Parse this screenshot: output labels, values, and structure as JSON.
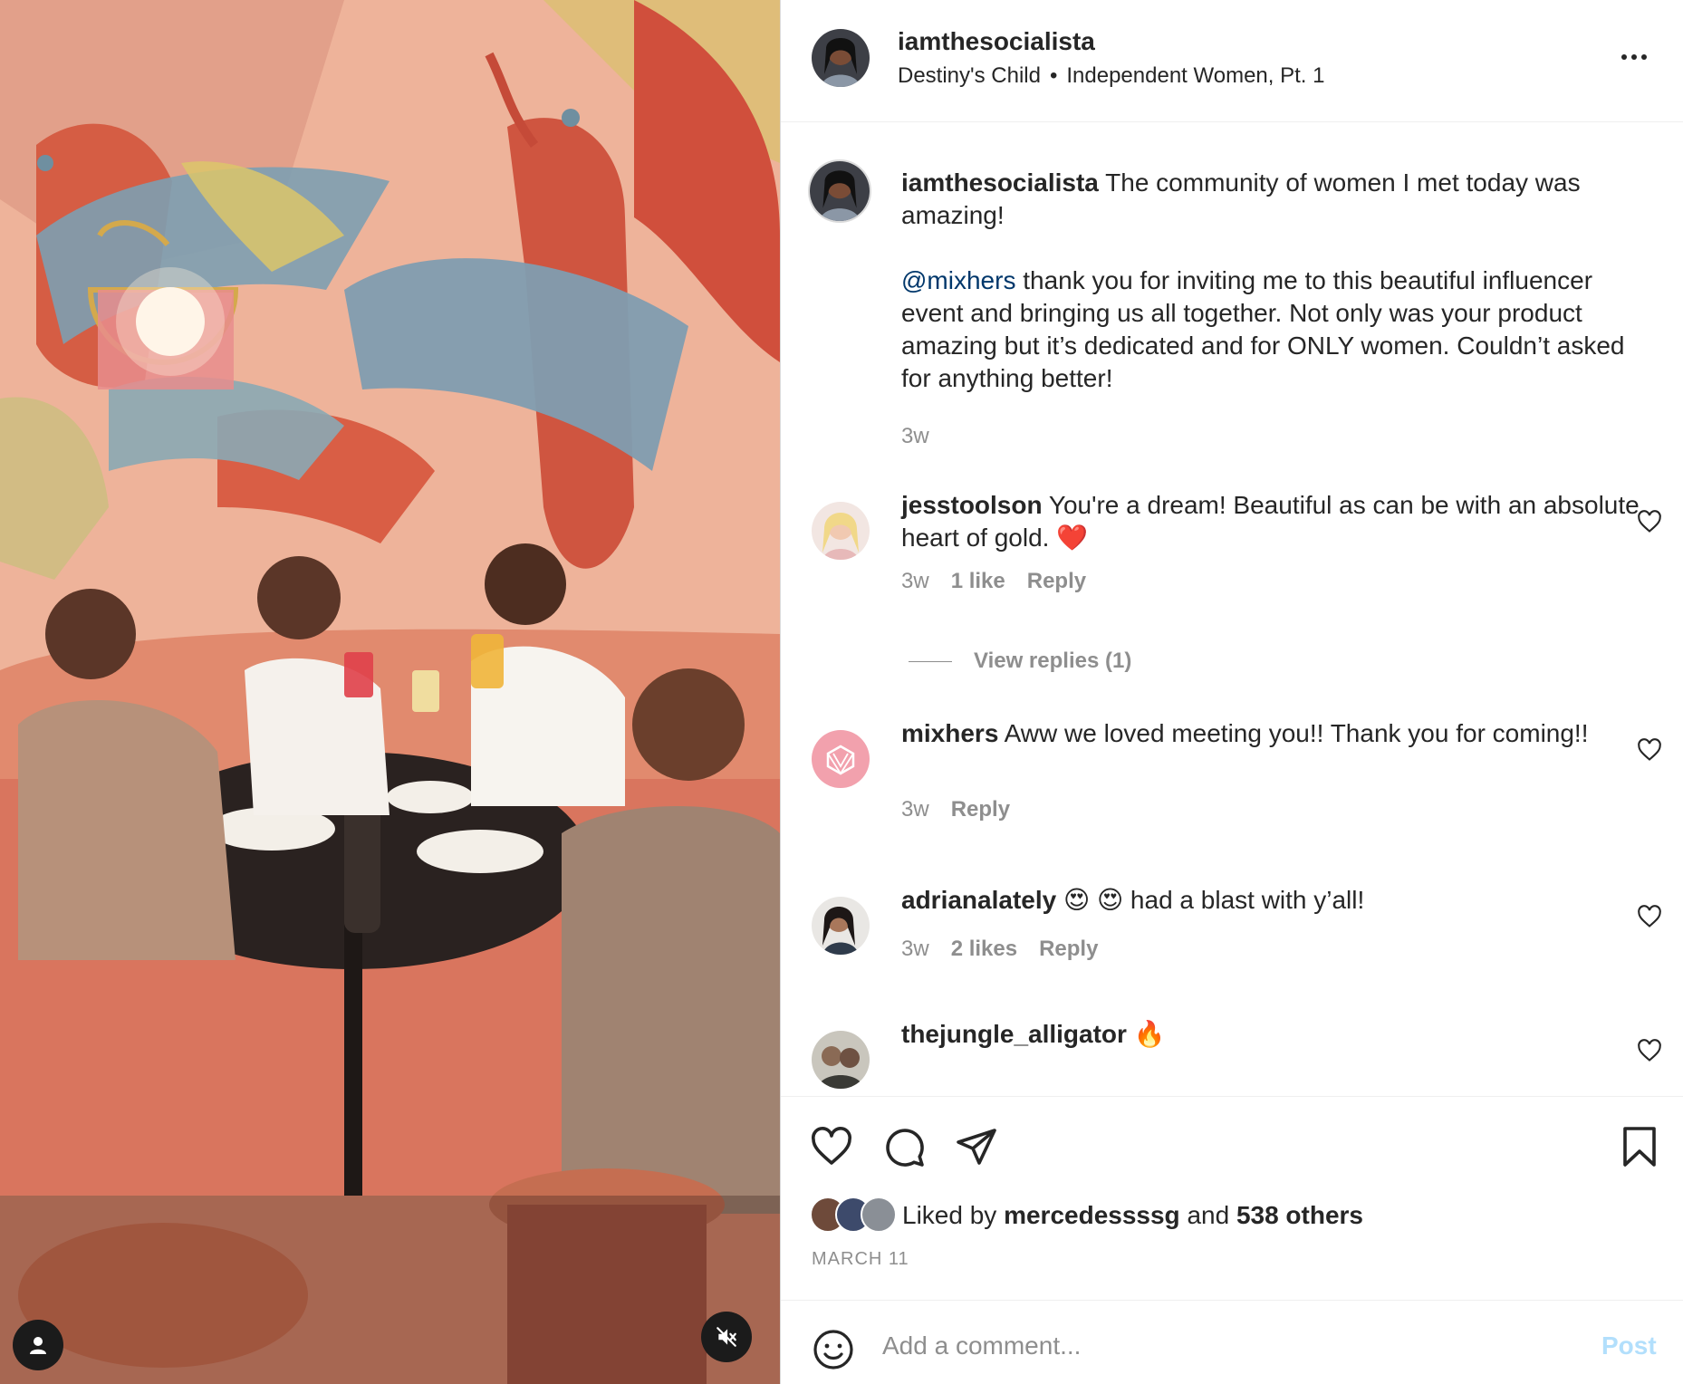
{
  "post": {
    "username": "iamthesocialista",
    "audio_artist": "Destiny's Child",
    "audio_separator": "•",
    "audio_track": "Independent Women, Pt. 1"
  },
  "caption": {
    "username": "iamthesocialista",
    "line1": "The community of women I met today was amazing!",
    "mention": "@mixhers",
    "line2": "thank you for inviting me to this beautiful influencer event and bringing us all together. Not only was your product amazing but it’s dedicated and for ONLY women. Couldn’t asked for anything better!",
    "time": "3w"
  },
  "comments": [
    {
      "username": "jesstoolson",
      "text": "You're a dream! Beautiful as can be with an absolute heart of gold. ❤️",
      "time": "3w",
      "likes": "1 like",
      "reply": "Reply"
    },
    {
      "username": "mixhers",
      "text": "Aww we loved meeting you!! Thank you for coming!!",
      "time": "3w",
      "reply": "Reply"
    },
    {
      "username": "adrianalately",
      "text": "😍 😍 had a blast with y’all!",
      "time": "3w",
      "likes": "2 likes",
      "reply": "Reply"
    },
    {
      "username": "thejungle_alligator",
      "text": "🔥"
    }
  ],
  "view_replies": "View replies (1)",
  "likes": {
    "prefix": "Liked by",
    "user": "mercedessssg",
    "joiner": "and",
    "others": "538 others"
  },
  "date": "MARCH 11",
  "add_comment": {
    "placeholder": "Add a comment...",
    "post_label": "Post"
  },
  "colors": {
    "link": "#00376b",
    "muted": "#8e8e8e",
    "post_disabled": "#b2dffc"
  },
  "icons": [
    "user-tag-icon",
    "mute-icon",
    "more-options-icon",
    "heart-icon",
    "comment-icon",
    "share-icon",
    "bookmark-icon",
    "emoji-icon"
  ]
}
